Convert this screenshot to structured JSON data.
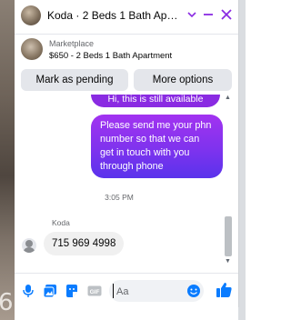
{
  "background": {
    "edge_glyph": "6"
  },
  "header": {
    "title": "Koda · 2 Beds 1 Bath Apart...",
    "icons": [
      "chevron-down-icon",
      "minimize-icon",
      "close-icon"
    ]
  },
  "marketplace": {
    "label": "Marketplace",
    "listing": "$650 - 2 Beds 1 Bath Apartment"
  },
  "actions": {
    "mark_pending": "Mark as pending",
    "more_options": "More options"
  },
  "messages": {
    "outgoing_partial": "Hi, this is still available",
    "outgoing": "Please send me your phn number so that we can get in touch with you through phone",
    "timestamp": "3:05 PM",
    "sender_name": "Koda",
    "incoming": "715 969 4998"
  },
  "composer": {
    "placeholder": "Aa",
    "icons": [
      "microphone-icon",
      "photo-icon",
      "sticker-icon",
      "gif-icon",
      "emoji-icon",
      "like-icon"
    ],
    "gif_label": "GIF"
  },
  "colors": {
    "accent": "#8a2be2",
    "outgoing_gradient_top": "#a233f0",
    "outgoing_gradient_bottom": "#5a33ec",
    "icon_blue": "#0a7cff",
    "header_icon": "#8a2be2"
  }
}
